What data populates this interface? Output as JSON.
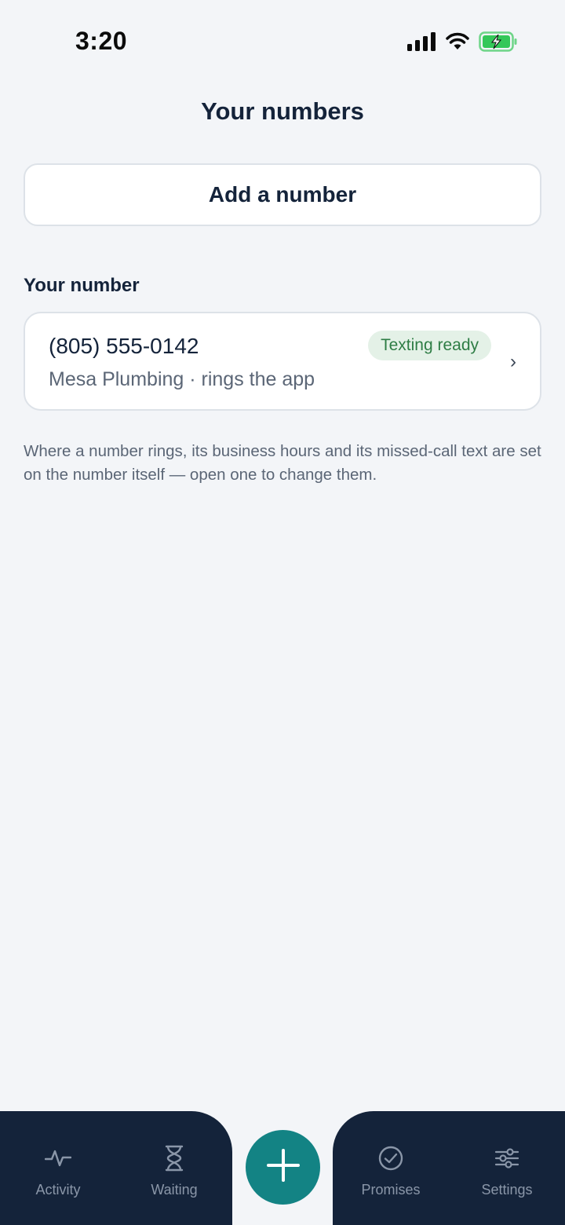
{
  "status_bar": {
    "time": "3:20",
    "icons": [
      "signal-icon",
      "wifi-icon",
      "battery-charging-icon"
    ],
    "battery_color": "#34c759"
  },
  "header": {
    "title": "Your numbers"
  },
  "add_button": {
    "label": "Add a number"
  },
  "section": {
    "label": "Your number"
  },
  "numbers": [
    {
      "number": "(805) 555-0142",
      "subtitle": "Mesa Plumbing · rings the app",
      "badge": "Texting ready",
      "badge_color": "#2e7d45"
    }
  ],
  "help_text": "Where a number rings, its business hours and its missed-call text are set on the number itself — open one to change them.",
  "tabbar": {
    "accent": "#138384",
    "background": "#14233a",
    "tabs": [
      {
        "label": "Activity",
        "icon": "activity-icon"
      },
      {
        "label": "Waiting",
        "icon": "hourglass-icon"
      },
      {
        "label": "Promises",
        "icon": "check-circle-icon"
      },
      {
        "label": "Settings",
        "icon": "sliders-icon"
      }
    ],
    "fab_icon": "plus-icon"
  }
}
